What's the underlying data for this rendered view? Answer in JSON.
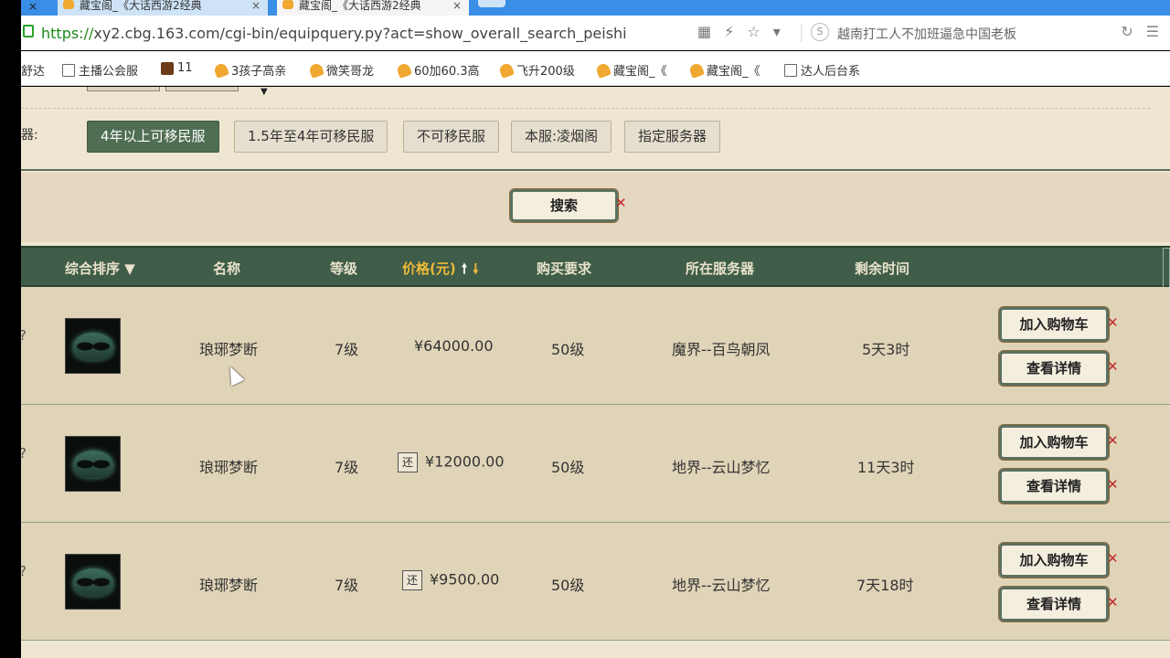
{
  "browser": {
    "tabs": [
      {
        "title": "藏宝阁_《大话西游2经典"
      },
      {
        "title": "藏宝阁_《大话西游2经典"
      }
    ],
    "url_proto": "https://",
    "url_rest": "xy2.cbg.163.com/cgi-bin/equipquery.py?act=show_overall_search_peishi",
    "search_engine_label": "S",
    "search_text": "越南打工人不加班逼急中国老板"
  },
  "bookmarks": [
    {
      "label": "舒达",
      "icon": "none"
    },
    {
      "label": "主播公会服",
      "icon": "page"
    },
    {
      "label": "11",
      "icon": "game"
    },
    {
      "label": "3孩子高亲",
      "icon": "gold"
    },
    {
      "label": "微笑哥龙",
      "icon": "gold"
    },
    {
      "label": "60加60.3高",
      "icon": "gold"
    },
    {
      "label": "飞升200级",
      "icon": "gold"
    },
    {
      "label": "藏宝阁_《",
      "icon": "gold"
    },
    {
      "label": "藏宝阁_《",
      "icon": "gold"
    },
    {
      "label": "达人后台系",
      "icon": "page"
    }
  ],
  "filters": {
    "server_label": "器:",
    "server_options": [
      "4年以上可移民服",
      "1.5年至4年可移民服",
      "不可移民服",
      "本服:凌烟阁",
      "指定服务器"
    ],
    "active_index": 0
  },
  "search_button": "搜索",
  "table": {
    "headers": {
      "sort": "综合排序 ▼",
      "name": "名称",
      "level": "等级",
      "price": "价格(元)",
      "requirement": "购买要求",
      "server": "所在服务器",
      "remaining": "剩余时间"
    },
    "rows": [
      {
        "name": "琅琊梦断",
        "level": "7级",
        "price": "¥64000.00",
        "returnable": false,
        "requirement": "50级",
        "server": "魔界--百鸟朝凤",
        "remaining": "5天3时",
        "add_cart": "加入购物车",
        "details": "查看详情"
      },
      {
        "name": "琅琊梦断",
        "level": "7级",
        "price": "¥12000.00",
        "returnable": true,
        "requirement": "50级",
        "server": "地界--云山梦忆",
        "remaining": "11天3时",
        "add_cart": "加入购物车",
        "details": "查看详情"
      },
      {
        "name": "琅琊梦断",
        "level": "7级",
        "price": "¥9500.00",
        "returnable": true,
        "requirement": "50级",
        "server": "地界--云山梦忆",
        "remaining": "7天18时",
        "add_cart": "加入购物车",
        "details": "查看详情"
      }
    ],
    "return_badge": "还"
  },
  "colors": {
    "page_bg": "#efe6d2",
    "header_bg": "#3f5d48",
    "active_filter": "#4f6e53",
    "price_header": "#f0b93a",
    "accent_red": "#c0282a"
  }
}
